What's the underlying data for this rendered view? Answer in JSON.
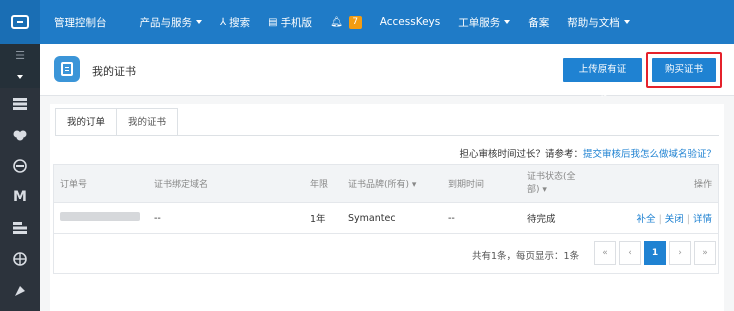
{
  "topbar": {
    "console_label": "管理控制台",
    "products_label": "产品与服务",
    "search_label": "搜索",
    "mobile_label": "手机版",
    "notification_count": "7",
    "accesskeys_label": "AccessKeys",
    "tickets_label": "工单服务",
    "beian_label": "备案",
    "help_label": "帮助与文档"
  },
  "sidebar": {
    "items": [
      "storage-icon",
      "cloud-icon",
      "cdn-icon",
      "m-icon",
      "list-icon",
      "globe-icon",
      "tag-icon"
    ]
  },
  "header": {
    "title": "我的证书",
    "upload_button": "上传原有证书",
    "buy_button": "购买证书"
  },
  "tabs": [
    {
      "label": "我的订单",
      "active": true
    },
    {
      "label": "我的证书",
      "active": false
    }
  ],
  "notice": {
    "text": "担心审核时间过长？请参考：",
    "link": "提交审核后我怎么做域名验证？"
  },
  "table": {
    "headers": {
      "order_no": "订单号",
      "domain": "证书绑定域名",
      "years": "年限",
      "brand": "证书品牌(所有)",
      "expire": "到期时间",
      "status": "证书状态(全部)",
      "ops": "操作"
    },
    "rows": [
      {
        "domain": "--",
        "years": "1年",
        "brand": "Symantec",
        "expire": "--",
        "status": "待完成",
        "op1": "补全",
        "op2": "关闭",
        "op3": "详情"
      }
    ]
  },
  "pagination": {
    "summary": "共有1条，每页显示：1条",
    "first": "«",
    "prev": "‹",
    "current": "1",
    "next": "›",
    "last": "»"
  }
}
